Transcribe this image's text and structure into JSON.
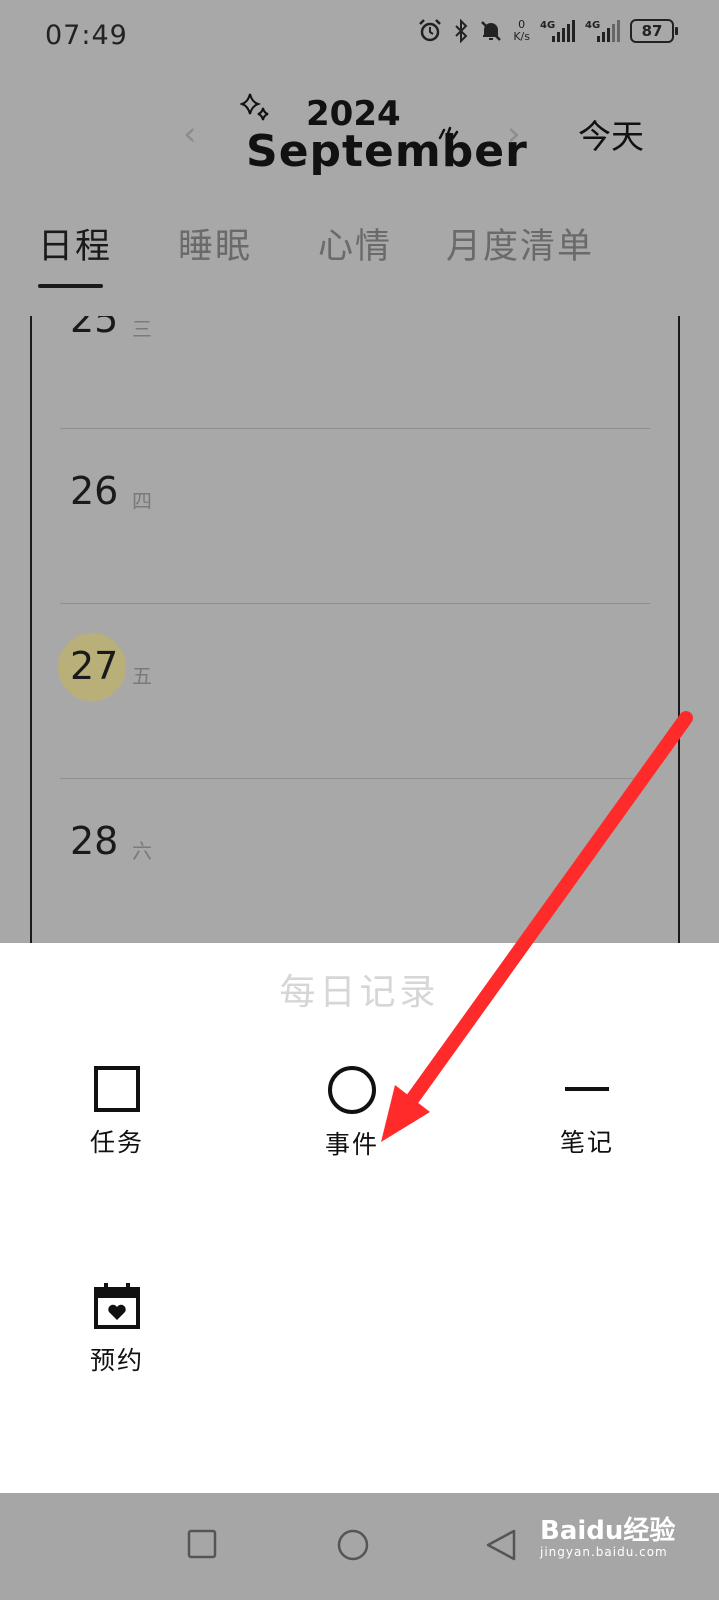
{
  "status": {
    "time": "07:49",
    "net_speed_value": "0",
    "net_speed_unit": "K/s",
    "signal1_label": "4G",
    "signal2_label": "4G",
    "battery": "87"
  },
  "header": {
    "year": "2024",
    "month": "September",
    "today_label": "今天",
    "prev_icon": "chevron-left-icon",
    "next_icon": "chevron-right-icon"
  },
  "tabs": [
    {
      "label": "日程",
      "active": true
    },
    {
      "label": "睡眠",
      "active": false
    },
    {
      "label": "心情",
      "active": false
    },
    {
      "label": "月度清单",
      "active": false
    }
  ],
  "days": [
    {
      "num": "25",
      "weekday": "三"
    },
    {
      "num": "26",
      "weekday": "四"
    },
    {
      "num": "27",
      "weekday": "五",
      "today": true
    },
    {
      "num": "28",
      "weekday": "六"
    }
  ],
  "sheet": {
    "title": "每日记录",
    "options": [
      {
        "label": "任务",
        "icon": "square-icon"
      },
      {
        "label": "事件",
        "icon": "circle-icon"
      },
      {
        "label": "笔记",
        "icon": "dash-icon"
      },
      {
        "label": "预约",
        "icon": "calendar-heart-icon"
      }
    ]
  },
  "colors": {
    "today_highlight": "#b9b079",
    "annotation_arrow": "#ff2a2a"
  },
  "watermark": {
    "brand": "Baidu经验",
    "url": "jingyan.baidu.com"
  }
}
